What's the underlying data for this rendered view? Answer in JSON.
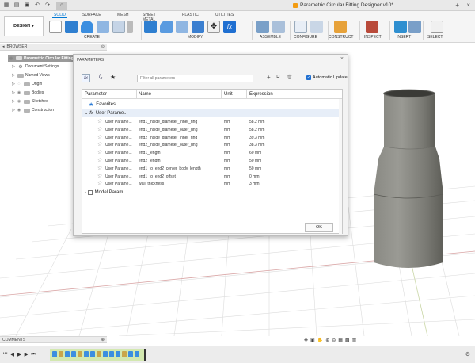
{
  "app": {
    "document_title": "Parametric Circular Fitting Designer v10*"
  },
  "ribbon": {
    "workspace_label": "DESIGN",
    "tabs": [
      "SOLID",
      "SURFACE",
      "MESH",
      "SHEET METAL",
      "PLASTIC",
      "UTILITIES"
    ],
    "active_tab": "SOLID",
    "groups": [
      "CREATE",
      "MODIFY",
      "ASSEMBLE",
      "CONFIGURE",
      "CONSTRUCT",
      "INSPECT",
      "INSERT",
      "SELECT"
    ]
  },
  "browser": {
    "title": "BROWSER",
    "root": "Parametric Circular Fitting Designer v10",
    "items": [
      "Document Settings",
      "Named Views",
      "Origin",
      "Bodies",
      "Sketches",
      "Construction"
    ]
  },
  "dialog": {
    "title": "PARAMETERS",
    "filter_placeholder": "Filter all parameters",
    "auto_update_label": "Automatic Update",
    "ok_label": "OK",
    "columns": [
      "Parameter",
      "Name",
      "Unit",
      "Expression"
    ],
    "favorites_label": "Favorites",
    "user_params_label": "User Parame...",
    "model_params_label": "Model Param...",
    "rows": [
      {
        "parameter": "User Parame...",
        "name": "end1_inside_diameter_inner_ring",
        "unit": "mm",
        "expression": "58.2 mm"
      },
      {
        "parameter": "User Parame...",
        "name": "end1_inside_diameter_outer_ring",
        "unit": "mm",
        "expression": "58.2 mm"
      },
      {
        "parameter": "User Parame...",
        "name": "end2_inside_diameter_inner_ring",
        "unit": "mm",
        "expression": "39.3 mm"
      },
      {
        "parameter": "User Parame...",
        "name": "end2_inside_diameter_outer_ring",
        "unit": "mm",
        "expression": "38.3 mm"
      },
      {
        "parameter": "User Parame...",
        "name": "end1_length",
        "unit": "mm",
        "expression": "60 mm"
      },
      {
        "parameter": "User Parame...",
        "name": "end2_length",
        "unit": "mm",
        "expression": "50 mm"
      },
      {
        "parameter": "User Parame...",
        "name": "end1_to_end2_center_body_length",
        "unit": "mm",
        "expression": "50 mm"
      },
      {
        "parameter": "User Parame...",
        "name": "end1_to_end2_offset",
        "unit": "mm",
        "expression": "0 mm"
      },
      {
        "parameter": "User Parame...",
        "name": "wall_thickness",
        "unit": "mm",
        "expression": "3 mm"
      }
    ]
  },
  "comments": {
    "label": "COMMENTS"
  }
}
